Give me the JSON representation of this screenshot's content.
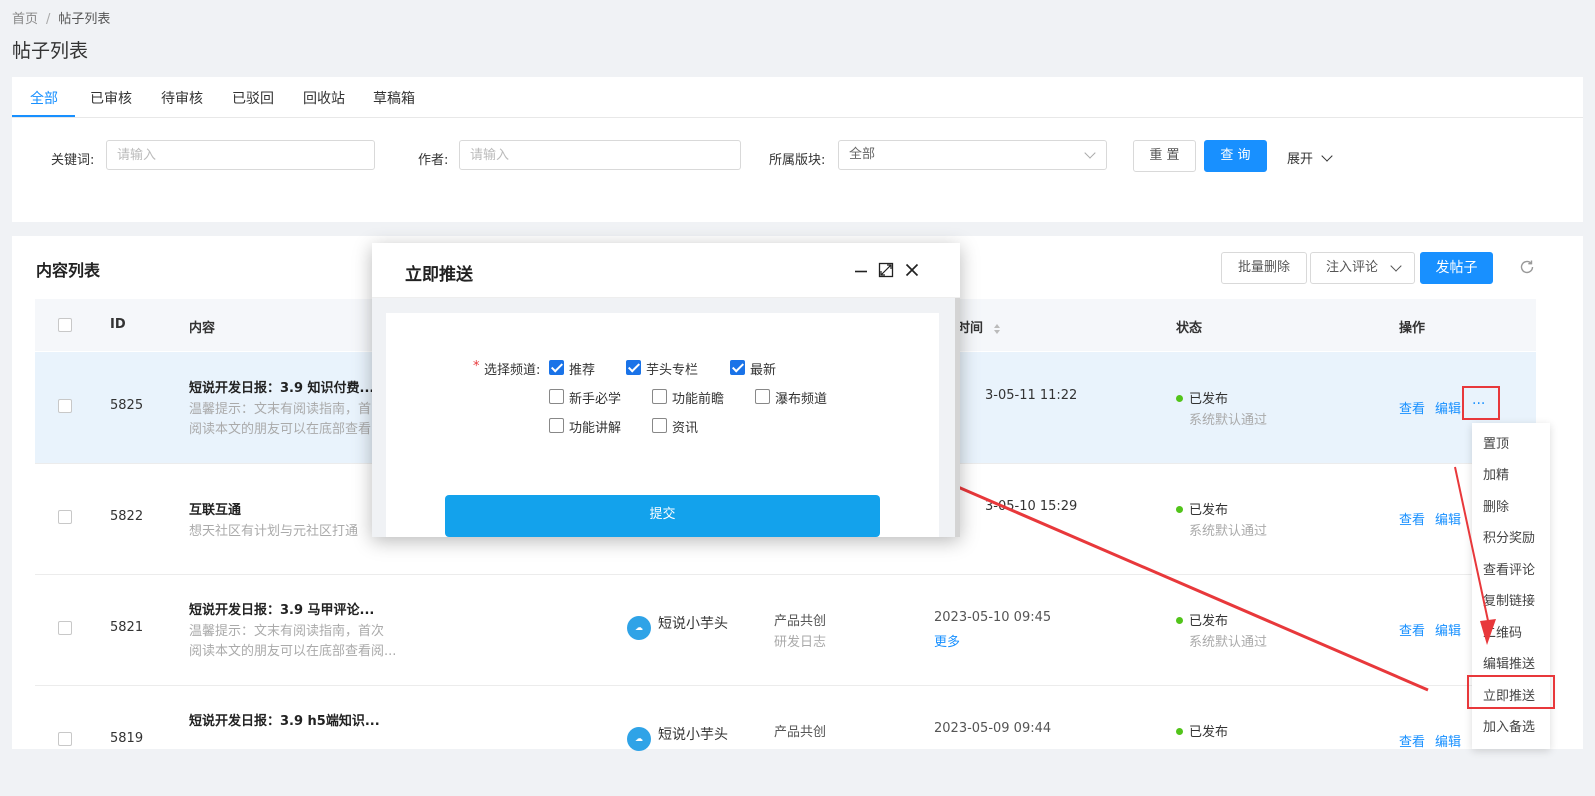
{
  "breadcrumb": {
    "home": "首页",
    "separator": "/",
    "current": "帖子列表"
  },
  "page_title": "帖子列表",
  "tabs": [
    {
      "label": "全部",
      "active": true
    },
    {
      "label": "已审核"
    },
    {
      "label": "待审核"
    },
    {
      "label": "已驳回"
    },
    {
      "label": "回收站"
    },
    {
      "label": "草稿箱"
    }
  ],
  "filters": {
    "keyword_label": "关键词:",
    "keyword_placeholder": "请输入",
    "author_label": "作者:",
    "author_placeholder": "请输入",
    "section_label": "所属版块:",
    "section_value": "全部",
    "reset_label": "重 置",
    "query_label": "查 询",
    "expand_label": "展开"
  },
  "list": {
    "title": "内容列表",
    "batch_delete": "批量删除",
    "inject_comment": "注入评论",
    "new_post": "发帖子",
    "columns": {
      "id": "ID",
      "content": "内容",
      "time": "时间",
      "status": "状态",
      "actions": "操作"
    },
    "rows": [
      {
        "id": "5825",
        "title": "短说开发日报：3.9 知识付费...",
        "desc1": "温馨提示：文末有阅读指南，首",
        "desc2": "阅读本文的朋友可以在底部查看",
        "time": "3-05-11 11:22",
        "status": "已发布",
        "status_note": "系统默认通过",
        "view": "查看",
        "edit": "编辑",
        "more": "···"
      },
      {
        "id": "5822",
        "title": "互联互通",
        "desc1": "想天社区有计划与元社区打通",
        "time": "3-05-10 15:29",
        "status": "已发布",
        "status_note": "系统默认通过",
        "view": "查看",
        "edit": "编辑"
      },
      {
        "id": "5821",
        "title": "短说开发日报：3.9 马甲评论...",
        "desc1": "温馨提示：文末有阅读指南，首次",
        "desc2": "阅读本文的朋友可以在底部查看阅...",
        "author": "短说小芋头",
        "board1": "产品共创",
        "board2": "研发日志",
        "time": "2023-05-10 09:45",
        "time_more": "更多",
        "status": "已发布",
        "status_note": "系统默认通过",
        "view": "查看",
        "edit": "编辑"
      },
      {
        "id": "5819",
        "title": "短说开发日报：3.9 h5端知识...",
        "author": "短说小芋头",
        "board1": "产品共创",
        "time": "2023-05-09 09:44",
        "status": "已发布",
        "view": "查看",
        "edit": "编辑"
      }
    ]
  },
  "menu": [
    "置顶",
    "加精",
    "删除",
    "积分奖励",
    "查看评论",
    "复制链接",
    "二维码",
    "编辑推送",
    "立即推送",
    "加入备选"
  ],
  "modal": {
    "title": "立即推送",
    "required_mark": "*",
    "field_label": "选择频道:",
    "options": [
      {
        "label": "推荐",
        "checked": true
      },
      {
        "label": "芋头专栏",
        "checked": true
      },
      {
        "label": "最新",
        "checked": true
      },
      {
        "label": "新手必学",
        "checked": false
      },
      {
        "label": "功能前瞻",
        "checked": false
      },
      {
        "label": "瀑布频道",
        "checked": false
      },
      {
        "label": "功能讲解",
        "checked": false
      },
      {
        "label": "资讯",
        "checked": false
      }
    ],
    "submit": "提交"
  },
  "colors": {
    "primary": "#1890ff",
    "submit": "#13a2ec",
    "annotation": "#e8383b",
    "status_ok": "#52c41a"
  }
}
